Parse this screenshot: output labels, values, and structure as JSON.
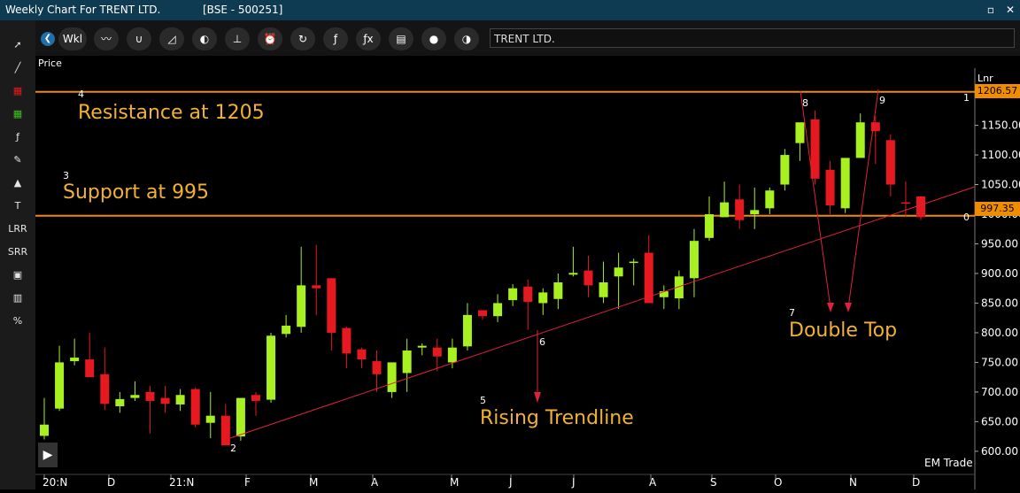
{
  "window": {
    "title": "Weekly Chart For TRENT LTD.",
    "exchange": "[BSE - 500251]",
    "controls": [
      "maximize-icon",
      "close-icon"
    ]
  },
  "sidebar": {
    "items": [
      {
        "name": "cursor-arrow-icon",
        "glyph": "➚"
      },
      {
        "name": "trendline-icon",
        "glyph": "╱"
      },
      {
        "name": "red-grid-icon",
        "glyph": "▦"
      },
      {
        "name": "green-grid-icon",
        "glyph": "▦"
      },
      {
        "name": "function-icon",
        "glyph": "ƒ"
      },
      {
        "name": "brush-icon",
        "glyph": "✎"
      },
      {
        "name": "shapes-icon",
        "glyph": "▲"
      },
      {
        "name": "text-icon",
        "glyph": "T"
      },
      {
        "name": "lrr-tool",
        "glyph": "LRR"
      },
      {
        "name": "srr-tool",
        "glyph": "SRR"
      },
      {
        "name": "image-icon",
        "glyph": "▣"
      },
      {
        "name": "bar-chart-icon",
        "glyph": "▥"
      },
      {
        "name": "percent-icon",
        "glyph": "%"
      }
    ]
  },
  "toolbar": {
    "period": "Wkl",
    "symbol": "TRENT LTD.",
    "buttons": [
      {
        "name": "line-chart-icon",
        "glyph": "〰"
      },
      {
        "name": "magnet-icon",
        "glyph": "∪"
      },
      {
        "name": "area-chart-icon",
        "glyph": "◿"
      },
      {
        "name": "mouse-icon",
        "glyph": "◐"
      },
      {
        "name": "bar-settings-icon",
        "glyph": "⊥"
      },
      {
        "name": "alarm-clock-icon",
        "glyph": "⏰"
      },
      {
        "name": "refresh-icon",
        "glyph": "↻"
      },
      {
        "name": "function-icon",
        "glyph": "ƒ"
      },
      {
        "name": "fx-icon",
        "glyph": "ƒx"
      },
      {
        "name": "film-icon",
        "glyph": "▤"
      },
      {
        "name": "white-circle-icon",
        "glyph": "●"
      },
      {
        "name": "half-moon-icon",
        "glyph": "◑"
      }
    ]
  },
  "chart": {
    "price_label": "Price",
    "scale_label": "Lnr",
    "watermark": "EM Trade",
    "price_tags": [
      "1206.57",
      "997.35"
    ],
    "annotations": [
      {
        "text": "Resistance at 1205",
        "color": "#f2b134"
      },
      {
        "text": "Support at 995",
        "color": "#f2b134"
      },
      {
        "text": "Rising Trendline",
        "color": "#f2b134"
      },
      {
        "text": "Double Top",
        "color": "#f2b134"
      }
    ],
    "markers": [
      "4",
      "3",
      "5",
      "6",
      "2",
      "7",
      "8",
      "9",
      "1",
      "0"
    ],
    "colors": {
      "up": "#a8f020",
      "down": "#e5191f",
      "support": "#f08c00",
      "trendline": "#e0203c"
    }
  },
  "chart_data": {
    "type": "candlestick",
    "yticks": [
      "600.00",
      "650.00",
      "700.00",
      "750.00",
      "800.00",
      "850.00",
      "900.00",
      "950.00",
      "1000.00",
      "1050.00",
      "1100.00",
      "1150.00"
    ],
    "xticks": [
      "20:N",
      "D",
      "21:N",
      "F",
      "M",
      "A",
      "M",
      "J",
      "J",
      "A",
      "S",
      "O",
      "N",
      "D"
    ],
    "horizontal_lines": [
      1206.57,
      997.35
    ],
    "ylim": [
      555,
      1230
    ],
    "candles": [
      [
        626,
        690,
        620,
        645
      ],
      [
        672,
        778,
        668,
        750
      ],
      [
        752,
        790,
        745,
        758
      ],
      [
        755,
        800,
        740,
        725
      ],
      [
        730,
        775,
        670,
        680
      ],
      [
        676,
        700,
        665,
        688
      ],
      [
        690,
        718,
        685,
        695
      ],
      [
        700,
        710,
        630,
        685
      ],
      [
        690,
        710,
        665,
        680
      ],
      [
        679,
        705,
        668,
        695
      ],
      [
        705,
        708,
        640,
        645
      ],
      [
        648,
        700,
        622,
        660
      ],
      [
        660,
        680,
        630,
        610
      ],
      [
        625,
        680,
        618,
        690
      ],
      [
        695,
        700,
        660,
        685
      ],
      [
        687,
        800,
        682,
        795
      ],
      [
        798,
        830,
        792,
        812
      ],
      [
        810,
        945,
        800,
        880
      ],
      [
        880,
        948,
        830,
        875
      ],
      [
        892,
        892,
        770,
        800
      ],
      [
        808,
        810,
        740,
        765
      ],
      [
        772,
        775,
        740,
        755
      ],
      [
        752,
        770,
        700,
        730
      ],
      [
        700,
        740,
        690,
        750
      ],
      [
        732,
        790,
        700,
        770
      ],
      [
        775,
        782,
        762,
        778
      ],
      [
        775,
        790,
        735,
        760
      ],
      [
        750,
        790,
        740,
        775
      ],
      [
        777,
        850,
        770,
        830
      ],
      [
        838,
        838,
        822,
        828
      ],
      [
        828,
        865,
        818,
        850
      ],
      [
        855,
        882,
        845,
        875
      ],
      [
        878,
        890,
        805,
        852
      ],
      [
        850,
        875,
        830,
        868
      ],
      [
        857,
        900,
        840,
        885
      ],
      [
        898,
        945,
        895,
        901
      ],
      [
        905,
        930,
        860,
        880
      ],
      [
        860,
        920,
        850,
        885
      ],
      [
        895,
        935,
        840,
        910
      ],
      [
        918,
        925,
        880,
        920
      ],
      [
        935,
        965,
        880,
        850
      ],
      [
        860,
        880,
        840,
        870
      ],
      [
        858,
        905,
        840,
        895
      ],
      [
        892,
        975,
        860,
        955
      ],
      [
        960,
        1030,
        955,
        1000
      ],
      [
        995,
        1055,
        1000,
        1020
      ],
      [
        1025,
        1050,
        975,
        990
      ],
      [
        1000,
        1045,
        975,
        1007
      ],
      [
        1010,
        1045,
        1000,
        1040
      ],
      [
        1050,
        1110,
        1040,
        1100
      ],
      [
        1120,
        1140,
        1090,
        1155
      ],
      [
        1160,
        1175,
        1050,
        1060
      ],
      [
        1075,
        1090,
        1000,
        1015
      ],
      [
        1010,
        1060,
        1002,
        1095
      ],
      [
        1095,
        1170,
        1095,
        1155
      ],
      [
        1155,
        1165,
        1085,
        1140
      ],
      [
        1125,
        1135,
        1030,
        1050
      ],
      [
        1020,
        1055,
        995,
        1019
      ],
      [
        1030,
        1030,
        990,
        995
      ]
    ]
  }
}
